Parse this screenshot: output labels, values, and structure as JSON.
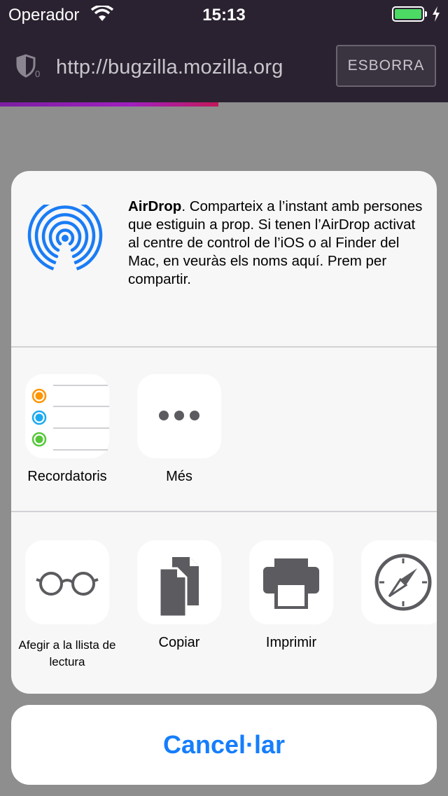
{
  "statusbar": {
    "carrier": "Operador",
    "time": "15:13"
  },
  "urlbar": {
    "url": "http://bugzilla.mozilla.org",
    "clear_label": "ESBORRA"
  },
  "sheet": {
    "airdrop_title": "AirDrop",
    "airdrop_text": ". Comparteix a l’instant amb persones que estiguin a prop. Si tenen l’AirDrop activat al centre de control de l’iOS o al Finder del Mac, en veuràs els noms aquí. Prem per compartir.",
    "apps": [
      {
        "label": "Recordatoris",
        "icon": "reminders-icon"
      },
      {
        "label": "Més",
        "icon": "more-icon"
      }
    ],
    "actions": [
      {
        "label": "Afegir a la llista de lectura",
        "icon": "glasses-icon"
      },
      {
        "label": "Copiar",
        "icon": "copy-icon"
      },
      {
        "label": "Imprimir",
        "icon": "printer-icon"
      },
      {
        "label": "",
        "icon": "compass-icon"
      }
    ],
    "cancel_label": "Cancel·lar"
  },
  "colors": {
    "accent": "#157efb",
    "airdrop_blue": "#1a7cf5",
    "battery": "#4cd964"
  }
}
